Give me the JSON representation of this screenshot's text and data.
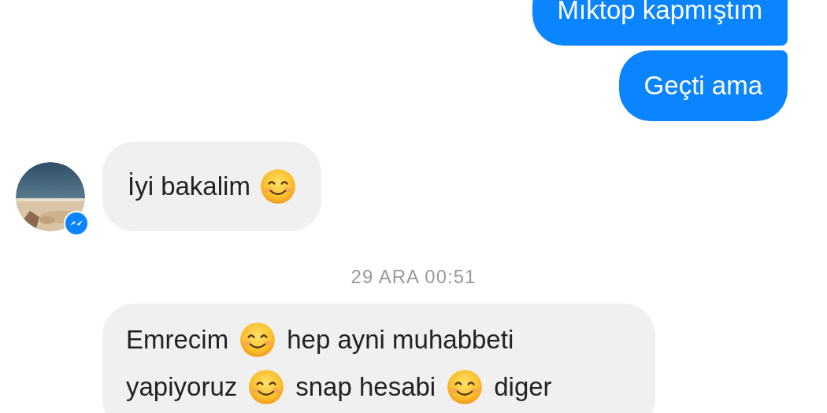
{
  "messages": [
    {
      "kind": "sent",
      "parts": [
        {
          "kind": "text",
          "text": "Mıktop kapmıştım"
        }
      ]
    },
    {
      "kind": "sent",
      "parts": [
        {
          "kind": "text",
          "text": "Geçti ama"
        }
      ]
    },
    {
      "kind": "received",
      "parts": [
        {
          "kind": "text",
          "text": "İyi bakalim"
        },
        {
          "kind": "emoji"
        }
      ]
    },
    {
      "kind": "timestamp",
      "text": "29 ARA 00:51"
    },
    {
      "kind": "received_long",
      "parts": [
        {
          "kind": "text",
          "text": "Emrecim"
        },
        {
          "kind": "emoji"
        },
        {
          "kind": "text",
          "text": "hep ayni muhabbeti"
        },
        {
          "kind": "text",
          "text": "yapiyoruz"
        },
        {
          "kind": "emoji"
        },
        {
          "kind": "text",
          "text": "snap hesabi"
        },
        {
          "kind": "emoji"
        },
        {
          "kind": "text",
          "text": "diger"
        }
      ]
    }
  ]
}
